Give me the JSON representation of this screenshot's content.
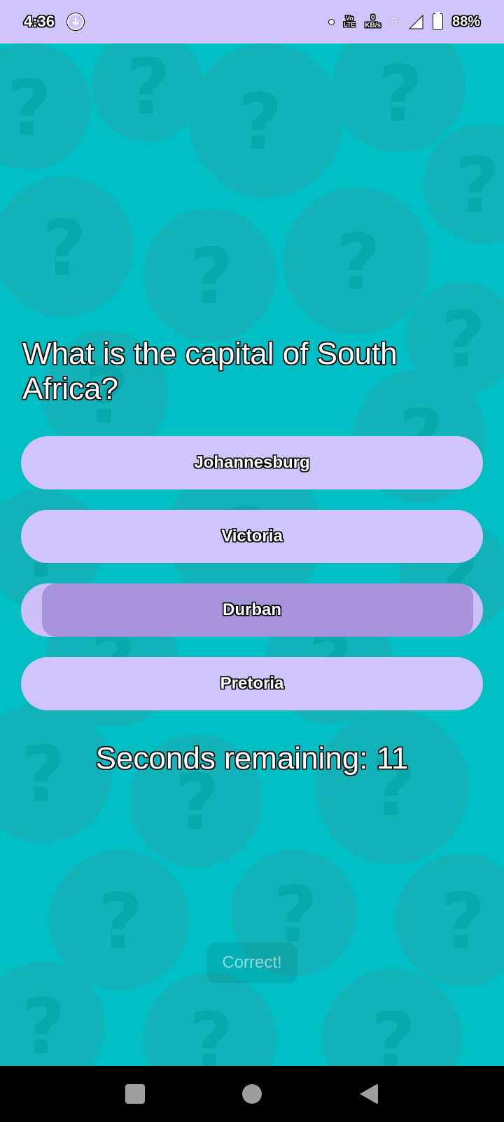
{
  "status_bar": {
    "time": "4:36",
    "volte_top": "Vo",
    "volte_bottom": "LTE",
    "net_speed_value": "0",
    "net_speed_unit": "KB/s",
    "roaming": "R",
    "battery_percent": "88%"
  },
  "quiz": {
    "question": "What is the capital of South Africa?",
    "answers": [
      {
        "label": "Johannesburg"
      },
      {
        "label": "Victoria"
      },
      {
        "label": "Durban"
      },
      {
        "label": "Pretoria"
      }
    ],
    "timer_text": "Seconds remaining: 11",
    "feedback_toast": "Correct!"
  },
  "colors": {
    "background": "#00bfc4",
    "accent": "#d1c4fc",
    "pressed": "#a793dd"
  },
  "icons": {
    "app_notification": "download-circle-icon",
    "signal": "cell-signal-icon",
    "battery": "battery-icon",
    "nav_recents": "square-icon",
    "nav_home": "circle-icon",
    "nav_back": "triangle-back-icon"
  }
}
